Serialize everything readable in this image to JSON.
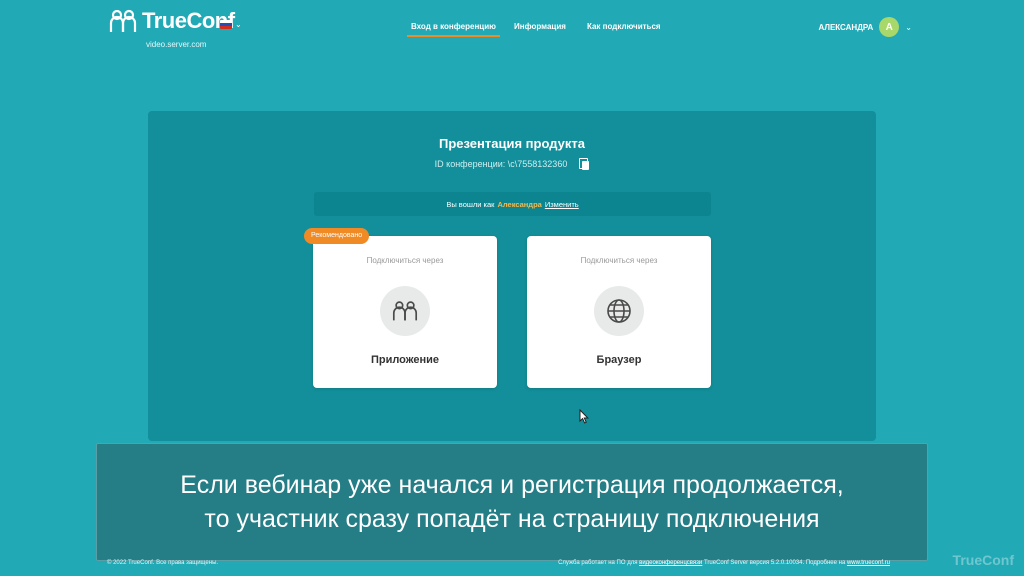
{
  "header": {
    "brand": "TrueConf",
    "server": "video.server.com",
    "nav": [
      "Вход в конференцию",
      "Информация",
      "Как подключиться"
    ],
    "user_name": "АЛЕКСАНДРА",
    "avatar_letter": "A"
  },
  "conference": {
    "title": "Презентация продукта",
    "id_text": "ID конференции: \\c\\7558132360",
    "login_prefix": "Вы вошли как",
    "login_name": "Александра",
    "change_link": "Изменить",
    "badge": "Рекомендовано",
    "cards": [
      {
        "sub": "Подключиться через",
        "label": "Приложение",
        "icon": "people-icon"
      },
      {
        "sub": "Подключиться через",
        "label": "Браузер",
        "icon": "globe-icon"
      }
    ]
  },
  "subtitle": {
    "line1": "Если вебинар уже начался и регистрация продолжается,",
    "line2": "то участник сразу попадёт на страницу подключения"
  },
  "footer": {
    "copyright": "© 2022 TrueConf. Все права защищены.",
    "service_prefix": "Служба работает на ПО для",
    "service_link": "видеоконференцсвязи",
    "service_middle": "TrueConf Server версия 5.2.0.10034. Подробнее на",
    "site_link": "www.trueconf.ru"
  },
  "watermark": "TrueConf",
  "colors": {
    "background": "#21a9b5",
    "panel": "#128f9a",
    "accent": "#f08a24",
    "avatar": "#a8d86a",
    "highlight_name": "#f6b84b"
  }
}
